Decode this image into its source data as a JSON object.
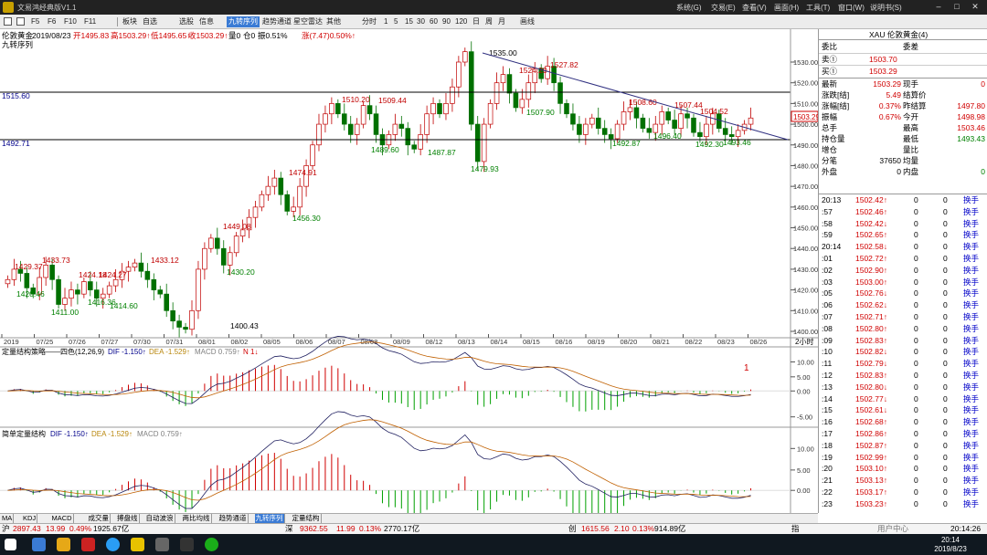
{
  "window": {
    "title": "文易鸿经典版V1.1",
    "menus": [
      "系统(G)",
      "交易(E)",
      "查看(V)",
      "画面(H)",
      "工具(T)",
      "窗口(W)",
      "说明书(S)"
    ]
  },
  "toolbar": {
    "items": [
      "板块",
      "自选",
      "选股",
      "信息",
      "九转序列",
      "趋势通道",
      "星空雷达",
      "其他",
      "分时",
      "1",
      "5",
      "15",
      "30",
      "60",
      "90",
      "120",
      "日",
      "周",
      "月",
      "画线"
    ],
    "active": "九转序列"
  },
  "chart_header": {
    "symbol": "伦敦黄金",
    "date": "2019/08/23",
    "open": "开1495.83",
    "high": "高1503.29↑",
    "low": "低1495.65↑",
    "close": "收1503.29↑",
    "vol": "量0",
    "pos": "仓0",
    "amp": "振0.51%",
    "chg": "涨(7.47)0.50%↑",
    "sub": "九转序列"
  },
  "indicator1": {
    "name": "定量结构策略——四色(12,26,9)",
    "dif": "DIF -1.150↑",
    "dea": "DEA -1.529↑",
    "macd": "MACD 0.759↑",
    "n": "N 1↓",
    "marker": "1"
  },
  "indicator2": {
    "name": "简单定量结构",
    "dif": "DIF -1.150↑",
    "dea": "DEA -1.529↑",
    "macd": "MACD 0.759↑"
  },
  "hlines": {
    "upper": "1515.60",
    "lower": "1492.71"
  },
  "price_labels": [
    "1535.00",
    "1524.20",
    "1527.82",
    "1510.20",
    "1509.44",
    "1507.90",
    "1508.60",
    "1507.44",
    "1504.52",
    "1496.40",
    "1492.30",
    "1493.46",
    "1492.87",
    "1489.60",
    "1487.87",
    "1479.93",
    "1474.91",
    "1456.30",
    "1449.08",
    "1430.20",
    "1433.73",
    "1429.37",
    "1420.46",
    "1411.00",
    "1424.18",
    "1424.27",
    "1416.36",
    "1414.60",
    "1433.12",
    "1400.43"
  ],
  "xaxis": [
    "2019",
    "07/25",
    "07/26",
    "07/27",
    "07/30",
    "07/31",
    "08/01",
    "08/02",
    "08/05",
    "08/06",
    "08/07",
    "08/08",
    "08/09",
    "08/12",
    "08/13",
    "08/14",
    "08/15",
    "08/16",
    "08/19",
    "08/20",
    "08/21",
    "08/22",
    "08/23",
    "08/26"
  ],
  "xaxis_right": "2小时",
  "yaxis": [
    "1530.00",
    "1520.00",
    "1510.00",
    "1500.00",
    "1490.00",
    "1480.00",
    "1470.00",
    "1460.00",
    "1450.00",
    "1440.00",
    "1430.00",
    "1420.00",
    "1410.00",
    "1400.00"
  ],
  "current_price": "1503.29",
  "ind1_axis": [
    "10.00",
    "5.00",
    "0.00",
    "-5.00"
  ],
  "ind2_axis": [
    "10.00",
    "5.00",
    "0.00",
    "-5.00"
  ],
  "chart_data": {
    "type": "candlestick",
    "ylim": [
      1397,
      1537
    ],
    "points": [
      1425,
      1430,
      1428,
      1421,
      1418,
      1426,
      1432,
      1425,
      1413,
      1416,
      1420,
      1418,
      1424,
      1420,
      1416,
      1418,
      1422,
      1425,
      1429,
      1431,
      1433,
      1429,
      1425,
      1420,
      1418,
      1410,
      1405,
      1402,
      1401,
      1410,
      1430,
      1440,
      1445,
      1440,
      1432,
      1438,
      1446,
      1449,
      1455,
      1460,
      1466,
      1470,
      1474,
      1466,
      1458,
      1460,
      1470,
      1480,
      1490,
      1500,
      1505,
      1510,
      1505,
      1500,
      1495,
      1500,
      1509,
      1505,
      1495,
      1490,
      1495,
      1500,
      1498,
      1490,
      1488,
      1495,
      1505,
      1510,
      1505,
      1510,
      1518,
      1530,
      1535,
      1500,
      1482,
      1500,
      1510,
      1520,
      1524,
      1515,
      1508,
      1512,
      1520,
      1527,
      1522,
      1528,
      1520,
      1510,
      1505,
      1500,
      1495,
      1500,
      1503,
      1498,
      1495,
      1493,
      1500,
      1506,
      1508,
      1503,
      1498,
      1496,
      1500,
      1506,
      1502,
      1498,
      1505,
      1503,
      1496,
      1494,
      1500,
      1505,
      1498,
      1495,
      1494,
      1497,
      1500,
      1503
    ]
  },
  "right": {
    "header": "XAU 伦敦黄金(4)",
    "committee": {
      "l": "委比",
      "r": "委差"
    },
    "sell": {
      "l": "卖①",
      "v": "1503.70"
    },
    "buy": {
      "l": "买①",
      "v": "1503.29"
    },
    "rows": [
      {
        "a": "最新",
        "b": "1503.29",
        "c": "现手",
        "d": "0"
      },
      {
        "a": "涨跌[结]",
        "b": "5.49",
        "c": "结算价",
        "d": ""
      },
      {
        "a": "涨幅[结]",
        "b": "0.37%",
        "c": "昨结算",
        "d": "1497.80"
      },
      {
        "a": "振幅",
        "b": "0.67%",
        "c": "今开",
        "d": "1498.98"
      },
      {
        "a": "总手",
        "b": "",
        "c": "最高",
        "d": "1503.46"
      },
      {
        "a": "持仓量",
        "b": "",
        "c": "最低",
        "d": "1493.43"
      },
      {
        "a": "增仓",
        "b": "",
        "c": "量比",
        "d": ""
      },
      {
        "a": "分笔",
        "b": "37650",
        "c": "均量",
        "d": ""
      },
      {
        "a": "外盘",
        "b": "0",
        "c": "内盘",
        "d": "0"
      }
    ],
    "ticks": [
      {
        "t": "20:13",
        "p": "1502.42↑",
        "v": "0",
        "o": "0",
        "k": "换手"
      },
      {
        "t": ":57",
        "p": "1502.46↑",
        "v": "0",
        "o": "0",
        "k": "换手"
      },
      {
        "t": ":58",
        "p": "1502.42↓",
        "v": "0",
        "o": "0",
        "k": "换手"
      },
      {
        "t": ":59",
        "p": "1502.65↑",
        "v": "0",
        "o": "0",
        "k": "换手"
      },
      {
        "t": "20:14",
        "p": "1502.58↓",
        "v": "0",
        "o": "0",
        "k": "换手"
      },
      {
        "t": ":01",
        "p": "1502.72↑",
        "v": "0",
        "o": "0",
        "k": "换手"
      },
      {
        "t": ":02",
        "p": "1502.90↑",
        "v": "0",
        "o": "0",
        "k": "换手"
      },
      {
        "t": ":03",
        "p": "1503.00↑",
        "v": "0",
        "o": "0",
        "k": "换手"
      },
      {
        "t": ":05",
        "p": "1502.76↓",
        "v": "0",
        "o": "0",
        "k": "换手"
      },
      {
        "t": ":06",
        "p": "1502.62↓",
        "v": "0",
        "o": "0",
        "k": "换手"
      },
      {
        "t": ":07",
        "p": "1502.71↑",
        "v": "0",
        "o": "0",
        "k": "换手"
      },
      {
        "t": ":08",
        "p": "1502.80↑",
        "v": "0",
        "o": "0",
        "k": "换手"
      },
      {
        "t": ":09",
        "p": "1502.83↑",
        "v": "0",
        "o": "0",
        "k": "换手"
      },
      {
        "t": ":10",
        "p": "1502.82↓",
        "v": "0",
        "o": "0",
        "k": "换手"
      },
      {
        "t": ":11",
        "p": "1502.79↓",
        "v": "0",
        "o": "0",
        "k": "换手"
      },
      {
        "t": ":12",
        "p": "1502.83↑",
        "v": "0",
        "o": "0",
        "k": "换手"
      },
      {
        "t": ":13",
        "p": "1502.80↓",
        "v": "0",
        "o": "0",
        "k": "换手"
      },
      {
        "t": ":14",
        "p": "1502.77↓",
        "v": "0",
        "o": "0",
        "k": "换手"
      },
      {
        "t": ":15",
        "p": "1502.61↓",
        "v": "0",
        "o": "0",
        "k": "换手"
      },
      {
        "t": ":16",
        "p": "1502.68↑",
        "v": "0",
        "o": "0",
        "k": "换手"
      },
      {
        "t": ":17",
        "p": "1502.86↑",
        "v": "0",
        "o": "0",
        "k": "换手"
      },
      {
        "t": ":18",
        "p": "1502.87↑",
        "v": "0",
        "o": "0",
        "k": "换手"
      },
      {
        "t": ":19",
        "p": "1502.99↑",
        "v": "0",
        "o": "0",
        "k": "换手"
      },
      {
        "t": ":20",
        "p": "1503.10↑",
        "v": "0",
        "o": "0",
        "k": "换手"
      },
      {
        "t": ":21",
        "p": "1503.13↑",
        "v": "0",
        "o": "0",
        "k": "换手"
      },
      {
        "t": ":22",
        "p": "1503.17↑",
        "v": "0",
        "o": "0",
        "k": "换手"
      },
      {
        "t": ":23",
        "p": "1503.23↑",
        "v": "0",
        "o": "0",
        "k": "换手"
      }
    ]
  },
  "tabs": [
    "MA",
    "KDJ",
    "MACD",
    "成交量",
    "搏盘线",
    "自动波浪",
    "两比均线",
    "趋势通道",
    "九转序列",
    "定量结构"
  ],
  "tabs_active": "九转序列",
  "statusbar": {
    "sh": {
      "l": "沪",
      "v": "2897.43",
      "c": "13.99",
      "p": "0.49%",
      "a": "1925.67亿"
    },
    "sz": {
      "l": "深",
      "v": "9362.55",
      "c": "11.99",
      "p": "0.13%",
      "a": "2770.17亿"
    },
    "cy": {
      "l": "创",
      "v": "1615.56",
      "c": "2.10",
      "p": "0.13%",
      "a": "914.89亿"
    },
    "right_tab": "指",
    "right_tab2": "用户中心",
    "time": "20:14:26"
  },
  "taskbar": {
    "time": "20:14",
    "date": "2019/8/23"
  }
}
